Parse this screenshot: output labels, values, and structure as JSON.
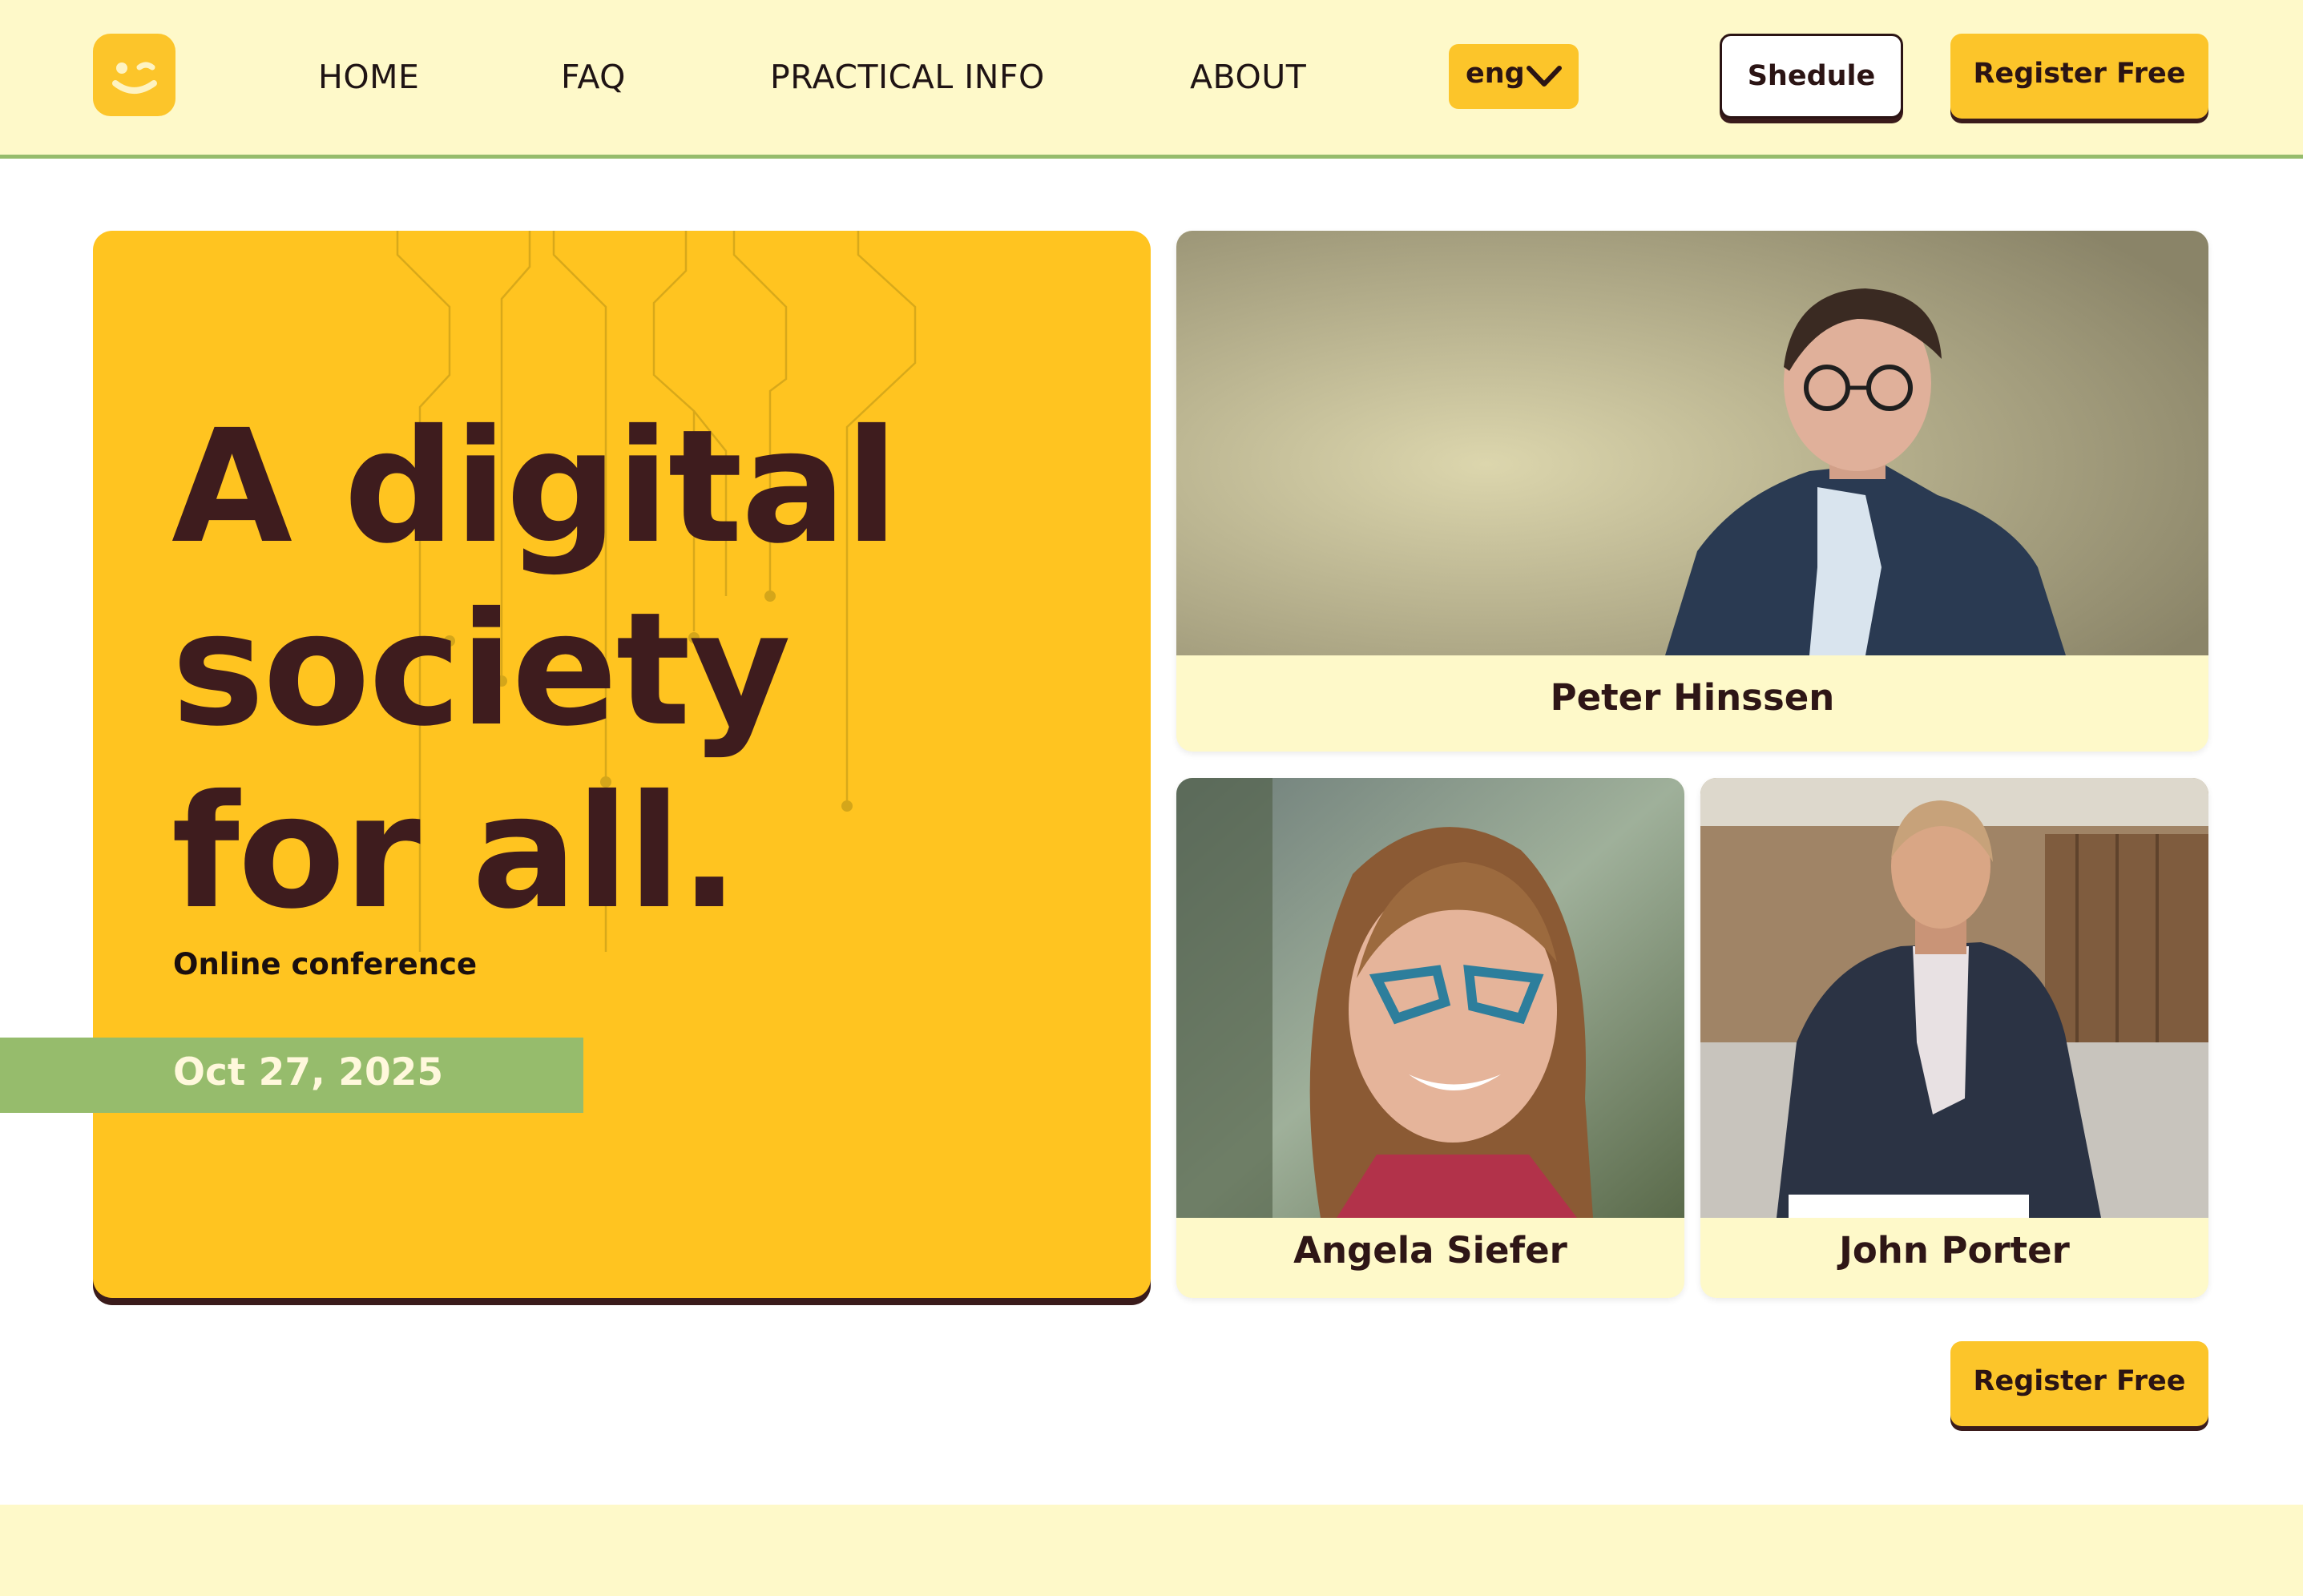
{
  "header": {
    "logo_icon": "winking-smiley-icon",
    "nav": [
      {
        "label": "HOME"
      },
      {
        "label": "FAQ"
      },
      {
        "label": "PRACTICAL INFO"
      },
      {
        "label": "ABOUT"
      }
    ],
    "language": {
      "value": "eng",
      "icon": "chevron-down-icon"
    },
    "schedule_label": "Shedule",
    "register_label": "Register Free"
  },
  "hero": {
    "title_lines": [
      "A digital",
      "society",
      "for all."
    ],
    "subtitle": "Online conference",
    "date": "Oct 27, 2025"
  },
  "speakers": [
    {
      "name": "Peter Hinssen"
    },
    {
      "name": "Angela Siefer"
    },
    {
      "name": "John Porter"
    }
  ],
  "cta": {
    "register_label": "Register Free"
  },
  "colors": {
    "accent_yellow": "#fcc52a",
    "hero_yellow": "#ffc420",
    "cream": "#fef9c9",
    "green": "#96bc6c",
    "dark_brown": "#3e1c1e"
  }
}
